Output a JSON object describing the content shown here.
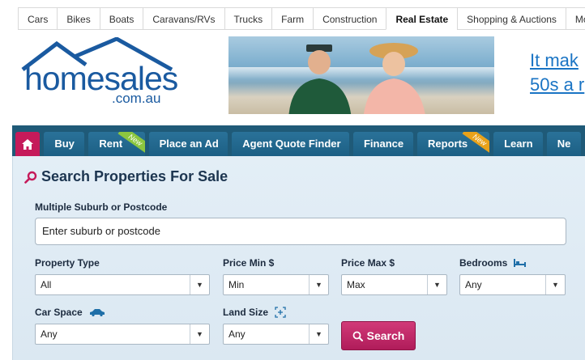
{
  "categories": [
    "Cars",
    "Bikes",
    "Boats",
    "Caravans/RVs",
    "Trucks",
    "Farm",
    "Construction",
    "Real Estate",
    "Shopping & Auctions",
    "Mo"
  ],
  "active_category": "Real Estate",
  "logo": {
    "word": "homesales",
    "domain": ".com.au"
  },
  "ad": {
    "line1": "It mak",
    "line2": "50s a r"
  },
  "nav": {
    "items": [
      {
        "label": "Buy",
        "badge": ""
      },
      {
        "label": "Rent",
        "badge": "New"
      },
      {
        "label": "Place an Ad",
        "badge": ""
      },
      {
        "label": "Agent Quote Finder",
        "badge": ""
      },
      {
        "label": "Finance",
        "badge": ""
      },
      {
        "label": "Reports",
        "badge": "New"
      },
      {
        "label": "Learn",
        "badge": ""
      },
      {
        "label": "Ne",
        "badge": ""
      }
    ]
  },
  "search": {
    "title": "Search Properties For Sale",
    "suburb_label": "Multiple Suburb or Postcode",
    "suburb_placeholder": "Enter suburb or postcode",
    "property_type": {
      "label": "Property Type",
      "value": "All"
    },
    "price_min": {
      "label": "Price Min $",
      "value": "Min"
    },
    "price_max": {
      "label": "Price Max $",
      "value": "Max"
    },
    "bedrooms": {
      "label": "Bedrooms",
      "value": "Any"
    },
    "car_space": {
      "label": "Car Space",
      "value": "Any"
    },
    "land_size": {
      "label": "Land Size",
      "value": "Any"
    },
    "button": "Search"
  },
  "colors": {
    "brand_blue": "#1a5aa0",
    "nav_bg": "#1f5a78",
    "accent": "#c51a5a"
  }
}
